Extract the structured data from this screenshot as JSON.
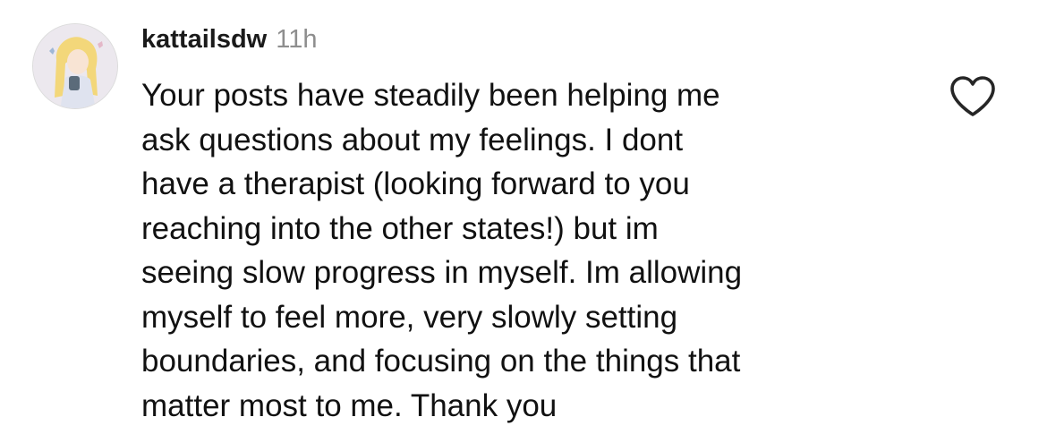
{
  "comment": {
    "username": "kattailsdw",
    "timestamp": "11h",
    "text": "Your posts have steadily been helping me\nask questions about my feelings. I dont\nhave a therapist (looking forward to you\nreaching into the other states!) but im\nseeing slow progress in myself. Im allowing\nmyself to feel more, very slowly setting\nboundaries, and focusing on the things that\nmatter most to me. Thank you",
    "like_icon": "heart-outline-icon",
    "avatar_icon": "cartoon-character-avatar"
  },
  "colors": {
    "username": "#1a1a1a",
    "timestamp": "#8e8e8e",
    "text": "#111111",
    "icon": "#262626",
    "background": "#ffffff"
  }
}
